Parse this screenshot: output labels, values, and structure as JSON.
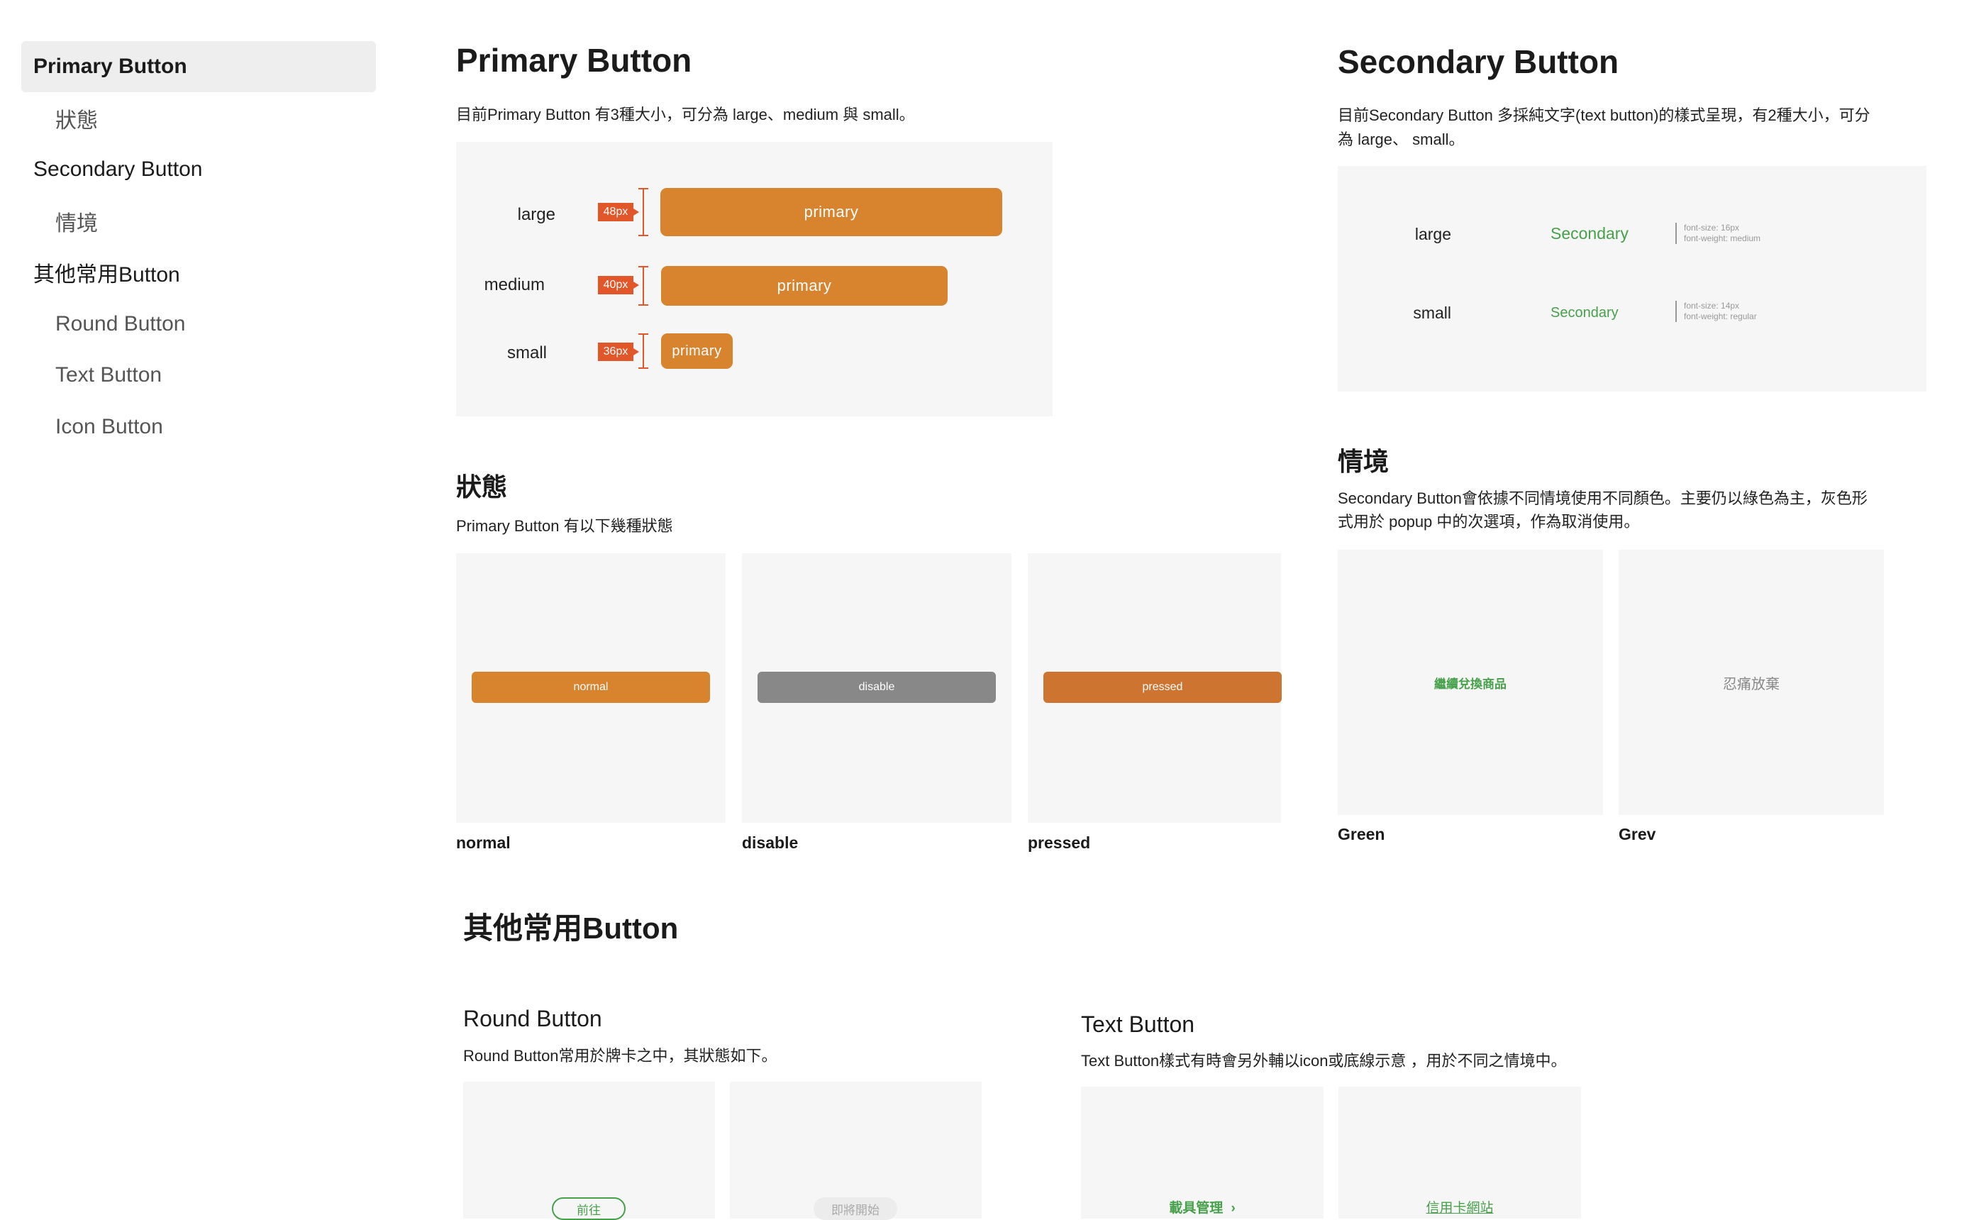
{
  "sidebar": {
    "items": [
      {
        "label": "Primary Button"
      },
      {
        "label": "狀態"
      },
      {
        "label": "Secondary Button"
      },
      {
        "label": "情境"
      },
      {
        "label": "其他常用Button"
      },
      {
        "label": "Round Button"
      },
      {
        "label": "Text Button"
      },
      {
        "label": "Icon Button"
      }
    ]
  },
  "primary": {
    "title": "Primary Button",
    "desc": "目前Primary Button 有3種大小，可分為 large、medium 與 small。",
    "sizes": [
      {
        "label": "large",
        "px": "48px",
        "button": "primary"
      },
      {
        "label": "medium",
        "px": "40px",
        "button": "primary"
      },
      {
        "label": "small",
        "px": "36px",
        "button": "primary"
      }
    ]
  },
  "states": {
    "title": "狀態",
    "desc": "Primary Button 有以下幾種狀態",
    "items": [
      {
        "button": "normal",
        "caption": "normal",
        "color": "#d8832e"
      },
      {
        "button": "disable",
        "caption": "disable",
        "color": "#888888"
      },
      {
        "button": "pressed",
        "caption": "pressed",
        "color": "#cc7430"
      }
    ]
  },
  "secondary": {
    "title": "Secondary Button",
    "desc_line1": "目前Secondary Button 多採純文字(text button)的樣式呈現，有2種大小，可分",
    "desc_line2": "為 large、 small。",
    "sizes": [
      {
        "label": "large",
        "button": "Secondary",
        "spec1": "font-size: 16px",
        "spec2": "font-weight: medium"
      },
      {
        "label": "small",
        "button": "Secondary",
        "spec1": "font-size: 14px",
        "spec2": "font-weight: regular"
      }
    ]
  },
  "context": {
    "title": "情境",
    "desc_line1": "Secondary Button會依據不同情境使用不同顏色。主要仍以綠色為主，灰色形",
    "desc_line2": "式用於 popup 中的次選項，作為取消使用。",
    "items": [
      {
        "button": "繼續兌換商品",
        "caption": "Green",
        "color": "#47a14b"
      },
      {
        "button": "忍痛放棄",
        "caption": "Grev",
        "color": "#888888"
      }
    ]
  },
  "others": {
    "title": "其他常用Button",
    "round": {
      "title": "Round Button",
      "desc": "Round Button常用於牌卡之中，其狀態如下。",
      "buttons": [
        "前往",
        "即將開始"
      ]
    },
    "text": {
      "title": "Text Button",
      "desc": "Text Button樣式有時會另外輔以icon或底線示意 ，用於不同之情境中。",
      "buttons": [
        "載具管理",
        "信用卡網站"
      ],
      "chevron": "›"
    }
  }
}
